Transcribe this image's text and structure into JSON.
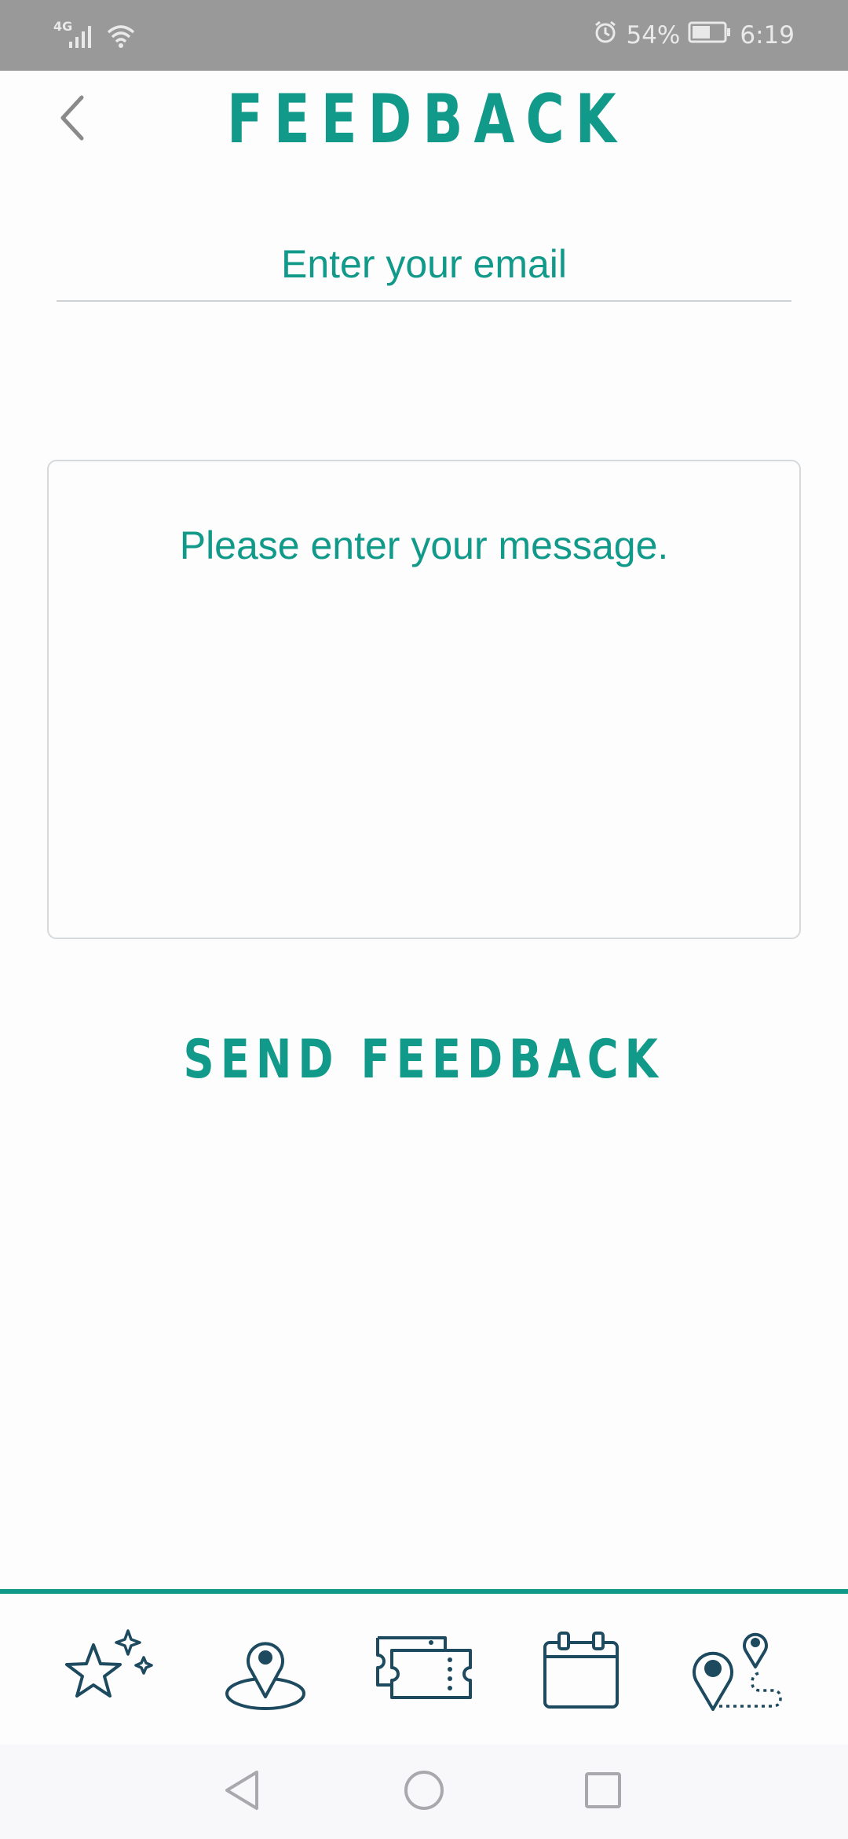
{
  "status_bar": {
    "network_type": "4G",
    "battery_percent": "54%",
    "time": "6:19",
    "icons": [
      "signal-icon",
      "wifi-icon",
      "alarm-icon",
      "battery-icon"
    ]
  },
  "header": {
    "title": "FEEDBACK",
    "back_icon": "chevron-left-icon"
  },
  "form": {
    "email_placeholder": "Enter your email",
    "email_value": "",
    "message_placeholder": "Please enter your message.",
    "message_value": "",
    "send_label": "SEND FEEDBACK"
  },
  "bottom_nav": {
    "items": [
      {
        "icon": "stars-icon"
      },
      {
        "icon": "map-pin-icon"
      },
      {
        "icon": "tickets-icon"
      },
      {
        "icon": "calendar-icon"
      },
      {
        "icon": "route-icon"
      }
    ]
  },
  "system_nav": {
    "buttons": [
      "back-triangle-icon",
      "home-circle-icon",
      "recents-square-icon"
    ]
  },
  "colors": {
    "accent": "#11998a",
    "status_bar": "#999999",
    "nav_icon": "#1d4a5e",
    "background": "#fdfdfe",
    "divider": "#cfd3d6"
  }
}
